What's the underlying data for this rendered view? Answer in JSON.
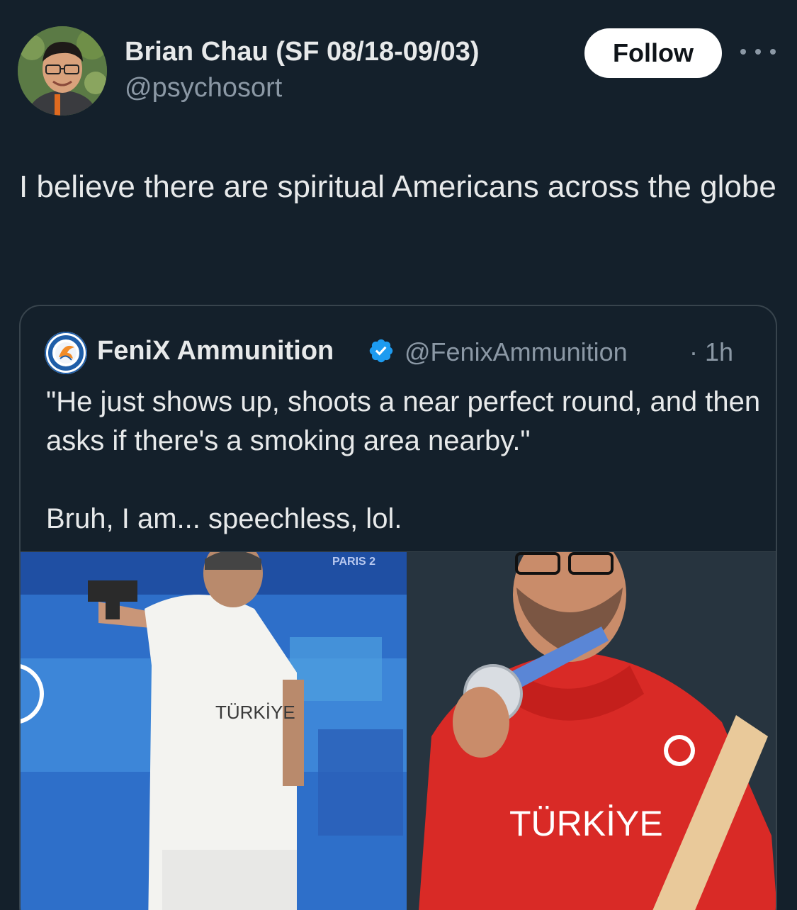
{
  "author": {
    "name": "Brian Chau (SF 08/18-09/03)",
    "handle": "@psychosort"
  },
  "actions": {
    "follow_label": "Follow",
    "more_icon": "more-horizontal-icon"
  },
  "tweet": {
    "text": "I believe there are spiritual Americans across the globe"
  },
  "quote": {
    "name": "FeniX Ammunition",
    "handle": "@FenixAmmunition",
    "time": "· 1h",
    "verified_icon": "verified-badge-icon",
    "text_line1": "\"He just shows up, shoots a near perfect round, and then asks if there's a smoking area nearby.\"",
    "text_line2": "Bruh, I am... speechless, lol.",
    "media": {
      "left_shirt_text": "TÜRKİYE",
      "right_jacket_text": "TÜRKİYE",
      "backdrop_text": "PARIS 2"
    }
  },
  "colors": {
    "background": "#14202b",
    "text": "#e7e9ea",
    "secondary": "#8b98a5",
    "verified": "#1d9bf0",
    "border": "#38444d"
  }
}
